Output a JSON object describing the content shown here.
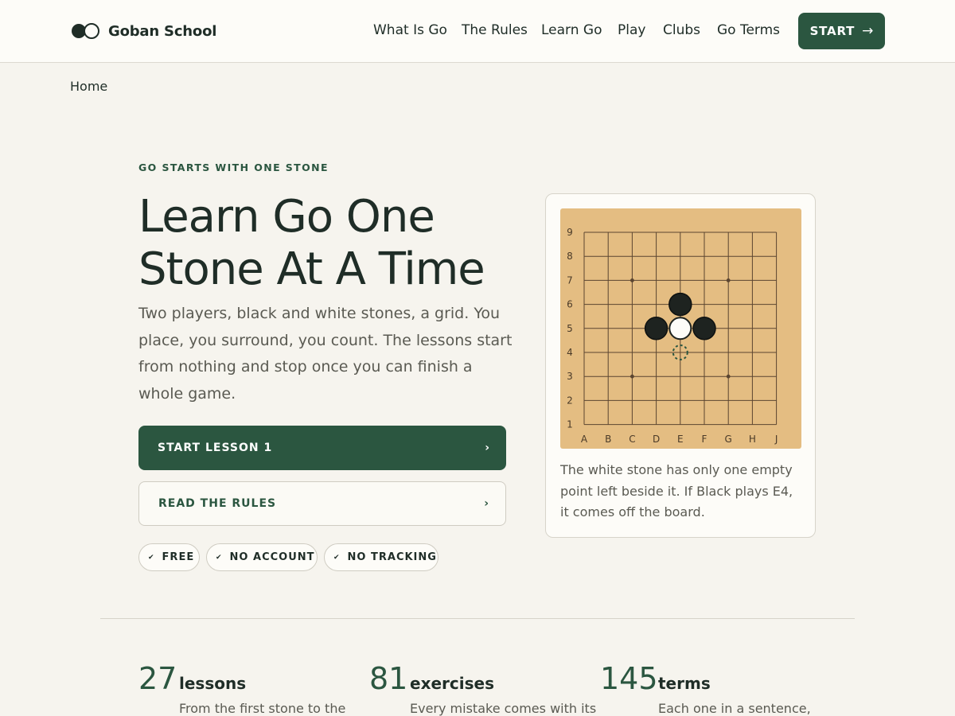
{
  "header": {
    "brand": "Goban School",
    "nav": [
      "What Is Go",
      "The Rules",
      "Learn Go",
      "Play",
      "Clubs",
      "Go Terms"
    ],
    "start_label": "START",
    "start_icon": "arrow-right-icon"
  },
  "breadcrumb": "Home",
  "hero": {
    "eyebrow": "GO STARTS WITH ONE STONE",
    "title": "Learn Go One Stone At A Time",
    "description": "Two players, black and white stones, a grid. You place, you surround, you count. The lessons start from nothing and stop once you can finish a whole game.",
    "primary_cta": "START LESSON 1",
    "secondary_cta": "READ THE RULES",
    "pills": [
      "FREE",
      "NO ACCOUNT",
      "NO TRACKING"
    ]
  },
  "board": {
    "columns": [
      "A",
      "B",
      "C",
      "D",
      "E",
      "F",
      "G",
      "H",
      "J"
    ],
    "rows": [
      "9",
      "8",
      "7",
      "6",
      "5",
      "4",
      "3",
      "2",
      "1"
    ],
    "star_points": [
      "C7",
      "G7",
      "C3",
      "G3"
    ],
    "black_stones": [
      "E6",
      "D5",
      "F5"
    ],
    "white_stones": [
      "E5"
    ],
    "hint_point": "E4",
    "caption": "The white stone has only one empty point left beside it. If Black plays E4, it comes off the board."
  },
  "stats": [
    {
      "number": "27",
      "label": "lessons",
      "desc": "From the first stone to the"
    },
    {
      "number": "81",
      "label": "exercises",
      "desc": "Every mistake comes with its"
    },
    {
      "number": "145",
      "label": "terms",
      "desc": "Each one in a sentence,"
    }
  ],
  "colors": {
    "accent": "#2b5640",
    "background": "#f6f4ee",
    "board_wood": "#e4bd82",
    "ink": "#1f2d27"
  }
}
